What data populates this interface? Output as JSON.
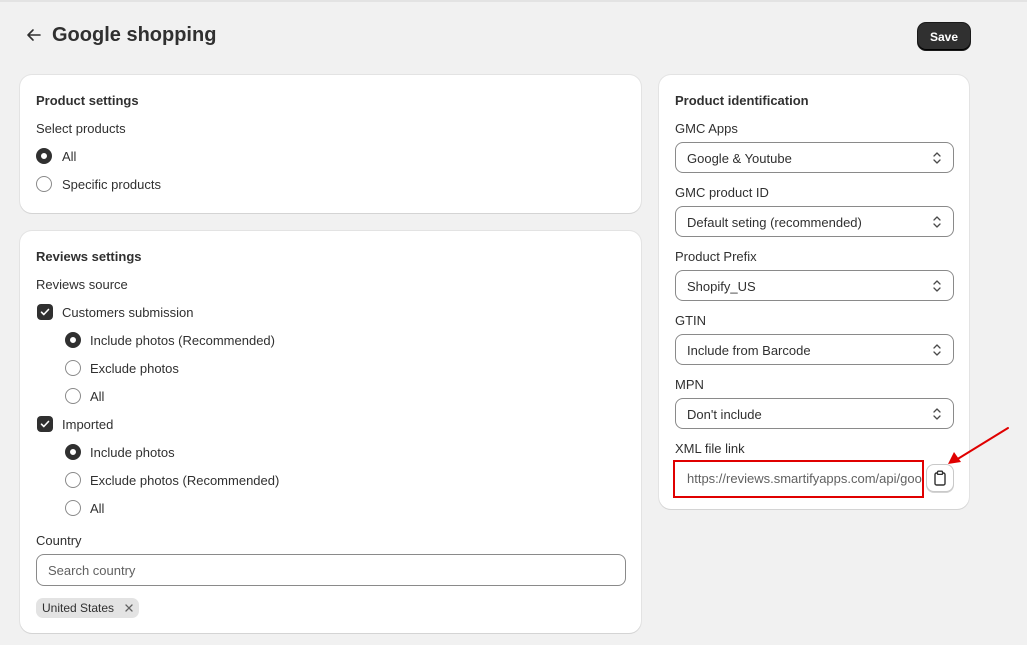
{
  "header": {
    "back_icon": "arrow-left-icon",
    "title": "Google shopping",
    "save_label": "Save"
  },
  "product_settings": {
    "title": "Product settings",
    "select_label": "Select products",
    "options": [
      {
        "label": "All",
        "selected": true
      },
      {
        "label": "Specific products",
        "selected": false
      }
    ]
  },
  "reviews_settings": {
    "title": "Reviews settings",
    "source_label": "Reviews source",
    "customers": {
      "label": "Customers submission",
      "checked": true,
      "options": [
        {
          "label": "Include photos (Recommended)",
          "selected": true
        },
        {
          "label": "Exclude photos",
          "selected": false
        },
        {
          "label": "All",
          "selected": false
        }
      ]
    },
    "imported": {
      "label": "Imported",
      "checked": true,
      "options": [
        {
          "label": "Include photos",
          "selected": true
        },
        {
          "label": "Exclude photos (Recommended)",
          "selected": false
        },
        {
          "label": "All",
          "selected": false
        }
      ]
    },
    "country_label": "Country",
    "country_placeholder": "Search country",
    "country_tags": [
      "United States"
    ]
  },
  "product_identification": {
    "title": "Product identification",
    "fields": [
      {
        "label": "GMC Apps",
        "value": "Google & Youtube"
      },
      {
        "label": "GMC product ID",
        "value": "Default seting (recommended)"
      },
      {
        "label": "Product Prefix",
        "value": "Shopify_US"
      },
      {
        "label": "GTIN",
        "value": "Include from Barcode"
      },
      {
        "label": "MPN",
        "value": "Don't include"
      }
    ],
    "xml_label": "XML file link",
    "xml_url": "https://reviews.smartifyapps.com/api/google-shopping",
    "copy_icon": "clipboard-icon"
  },
  "colors": {
    "highlight": "#e00000",
    "primary_button": "#303030",
    "background": "#f1f1f1"
  }
}
